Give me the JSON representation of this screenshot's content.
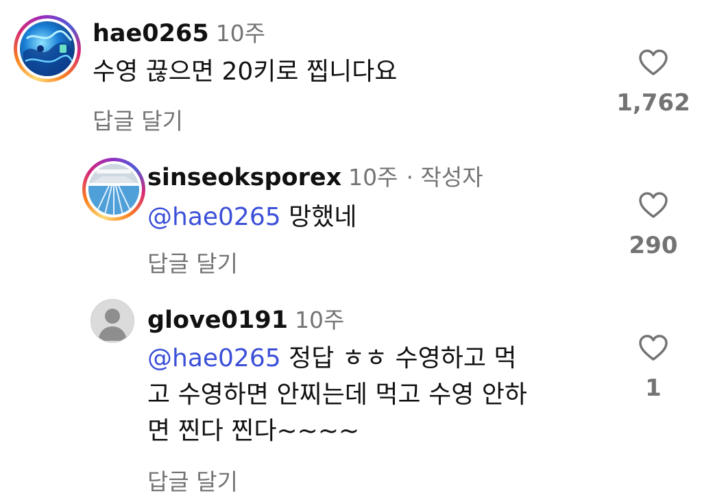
{
  "comments": [
    {
      "username": "hae0265",
      "time": "10주",
      "mention": "",
      "text": "수영 끊으면 20키로 찝니다요",
      "reply_label": "답글 달기",
      "like_count": "1,762",
      "avatar_icon": "blue-abstract-avatar"
    },
    {
      "username": "sinseoksporex",
      "time": "10주",
      "author_badge": "· 작성자",
      "mention": "@hae0265",
      "text": "망했네",
      "reply_label": "답글 달기",
      "like_count": "290",
      "avatar_icon": "swimming-pool-avatar"
    },
    {
      "username": "glove0191",
      "time": "10주",
      "mention": "@hae0265",
      "text_line1": "정답 ㅎㅎ 수영하고 먹",
      "text_line2": "고 수영하면 안찌는데 먹고 수영 안하",
      "text_line3": "면 찐다 찐다~~~~",
      "reply_label": "답글 달기",
      "like_count": "1",
      "avatar_icon": "default-user-avatar"
    }
  ],
  "colors": {
    "mention": "#3b4fd8",
    "secondary_text": "#737373",
    "primary_text": "#111111"
  }
}
